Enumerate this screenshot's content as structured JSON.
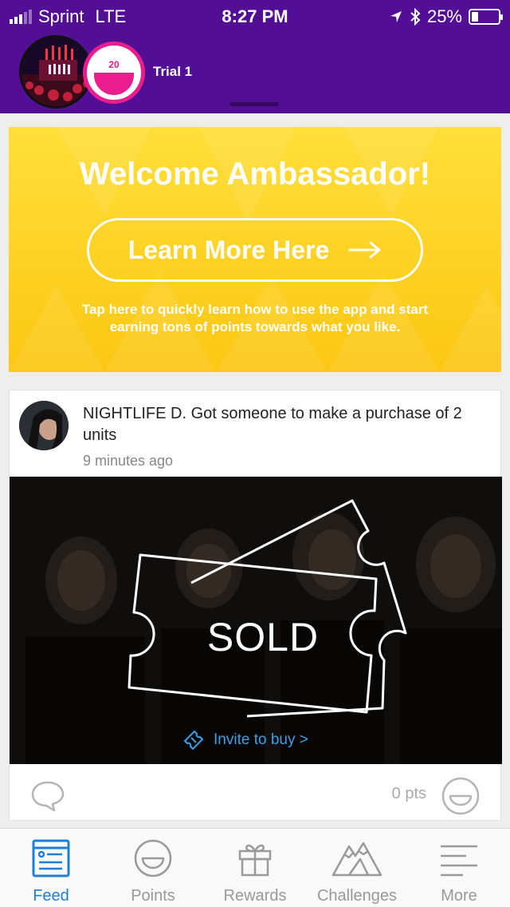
{
  "status_bar": {
    "carrier": "Sprint",
    "network": "LTE",
    "time": "8:27 PM",
    "battery_percent": "25%",
    "battery_level": 0.25
  },
  "header": {
    "points_value": "20",
    "title": "Trial 1",
    "background": "#520e94",
    "accent": "#e91e8c"
  },
  "banner": {
    "title": "Welcome Ambassador!",
    "button_label": "Learn More Here",
    "description": "Tap here to quickly learn how to use the app and start earning tons of points towards what you like."
  },
  "feed_item": {
    "text": "NIGHTLIFE D. Got someone to make a purchase of 2 units",
    "time_ago": "9 minutes ago",
    "overlay_text": "SOLD",
    "invite_label": "Invite to buy >",
    "points": "0 pts"
  },
  "tabs": [
    {
      "label": "Feed",
      "icon": "feed-icon",
      "active": true
    },
    {
      "label": "Points",
      "icon": "points-icon",
      "active": false
    },
    {
      "label": "Rewards",
      "icon": "gift-icon",
      "active": false
    },
    {
      "label": "Challenges",
      "icon": "mountain-icon",
      "active": false
    },
    {
      "label": "More",
      "icon": "menu-lines-icon",
      "active": false
    }
  ]
}
